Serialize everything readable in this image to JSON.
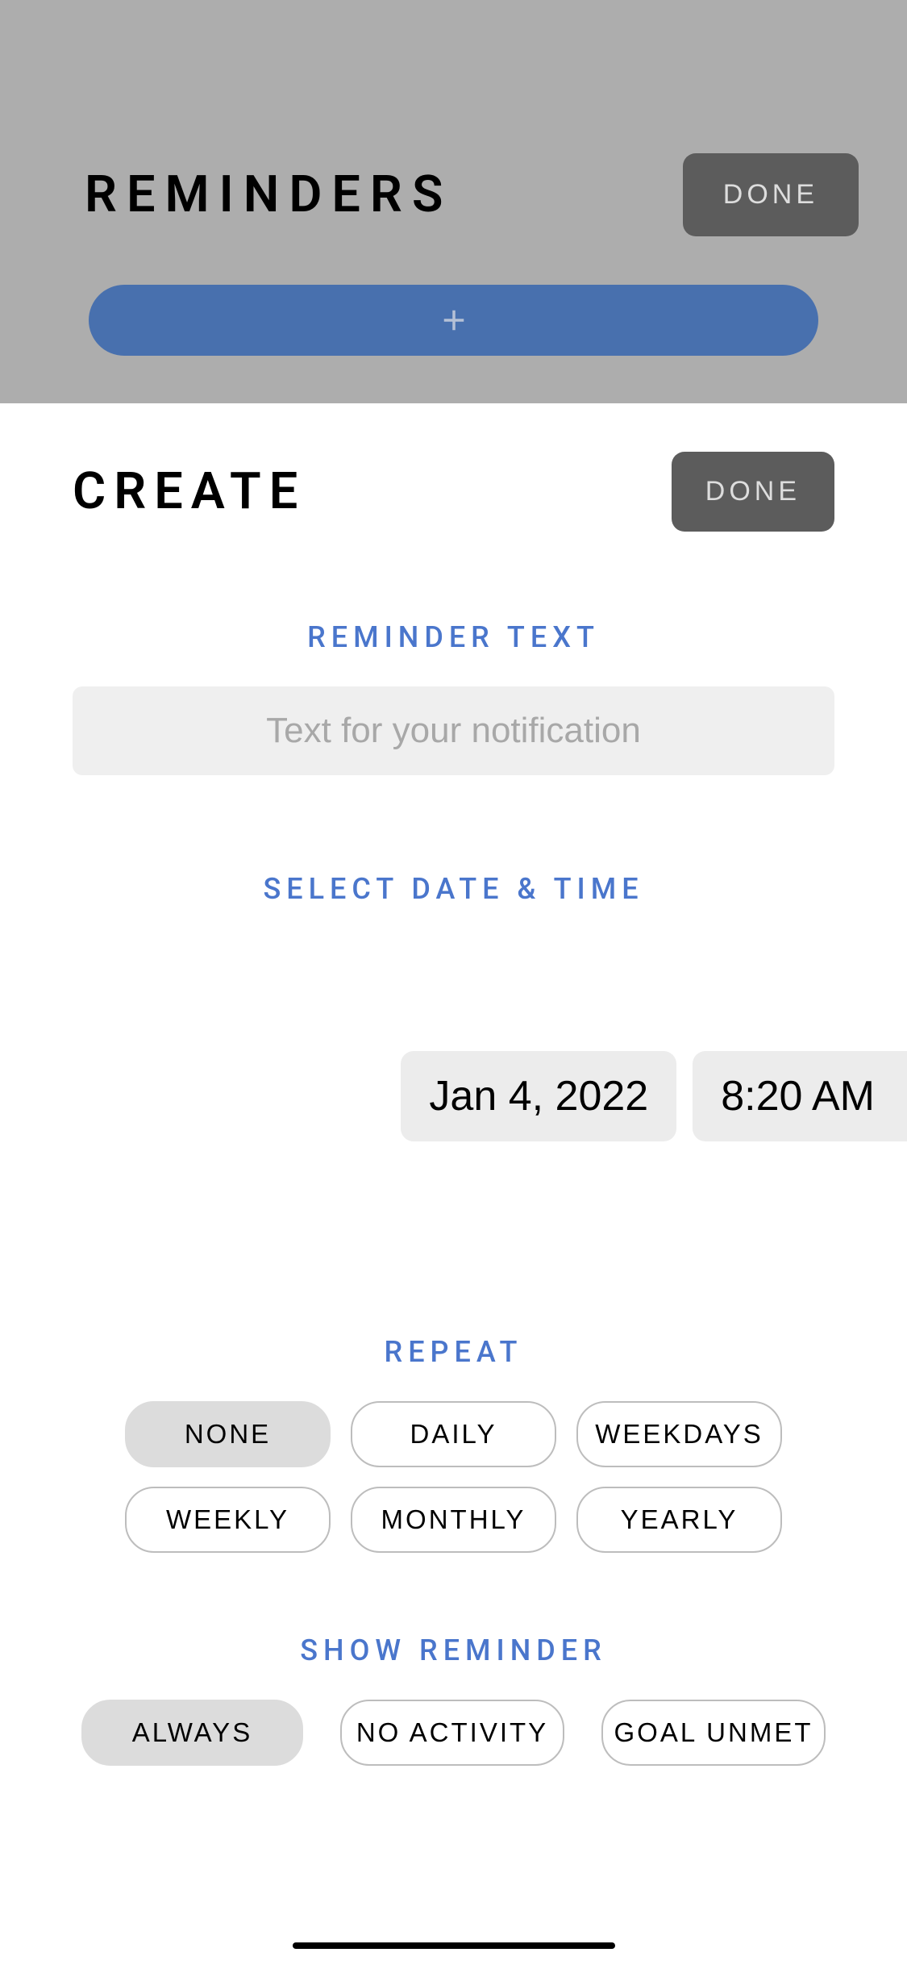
{
  "top": {
    "title": "REMINDERS",
    "done_label": "DONE",
    "add_icon": "plus-icon"
  },
  "create": {
    "title": "CREATE",
    "done_label": "DONE",
    "reminder_text": {
      "label": "REMINDER TEXT",
      "placeholder": "Text for your notification",
      "value": ""
    },
    "datetime": {
      "label": "SELECT DATE & TIME",
      "date": "Jan 4, 2022",
      "time": "8:20 AM"
    },
    "repeat": {
      "label": "REPEAT",
      "options": [
        "NONE",
        "DAILY",
        "WEEKDAYS",
        "WEEKLY",
        "MONTHLY",
        "YEARLY"
      ],
      "selected": "NONE"
    },
    "show_reminder": {
      "label": "SHOW REMINDER",
      "options": [
        "ALWAYS",
        "NO ACTIVITY",
        "GOAL UNMET"
      ],
      "selected": "ALWAYS"
    }
  },
  "colors": {
    "accent_blue": "#4a76cc",
    "button_blue": "#4870ae",
    "gray_bg": "#adadad",
    "dark_button": "#5c5c5c"
  }
}
